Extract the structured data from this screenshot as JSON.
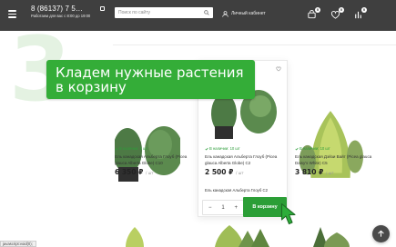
{
  "header": {
    "phone": "8 (86137) 7 5…",
    "hours": "Работаем для вас с 8:00 до 19:00",
    "search_placeholder": "Поиск по сайту",
    "account_label": "Личный кабинет",
    "cart_count": "0",
    "favorites_count": "0",
    "compare_count": "0"
  },
  "tutorial": {
    "step_number": "3",
    "banner_text": "Кладем нужные растения в корзину"
  },
  "products": [
    {
      "availability": "В наличии: 2 шт",
      "name": "Ель канадская Альберта Глоуб (Picea glauca Alberta Globe) C10",
      "price": "6 350 ₽",
      "unit": "/ шт"
    },
    {
      "availability": "В наличии: 10 шт",
      "name": "Ель канадская Альберта Глоуб (Picea glauca Alberta Globe) C2",
      "price": "2 500 ₽",
      "unit": "/ шт",
      "variant": "Ель канадская Альберта Глоуб C2",
      "quantity": "1",
      "add_to_cart": "В корзину"
    },
    {
      "availability": "В наличии: 10 шт",
      "name": "Ель канадская Дэйзи Вайт (Picea glauca Daisy's White) C5",
      "price": "3 810 ₽",
      "unit": "/ шт"
    }
  ],
  "status_bar": "javascript:void(0);",
  "colors": {
    "header_bg": "#3f3f3f",
    "brand_green": "#2b9e36",
    "banner_green": "#34ad38"
  }
}
